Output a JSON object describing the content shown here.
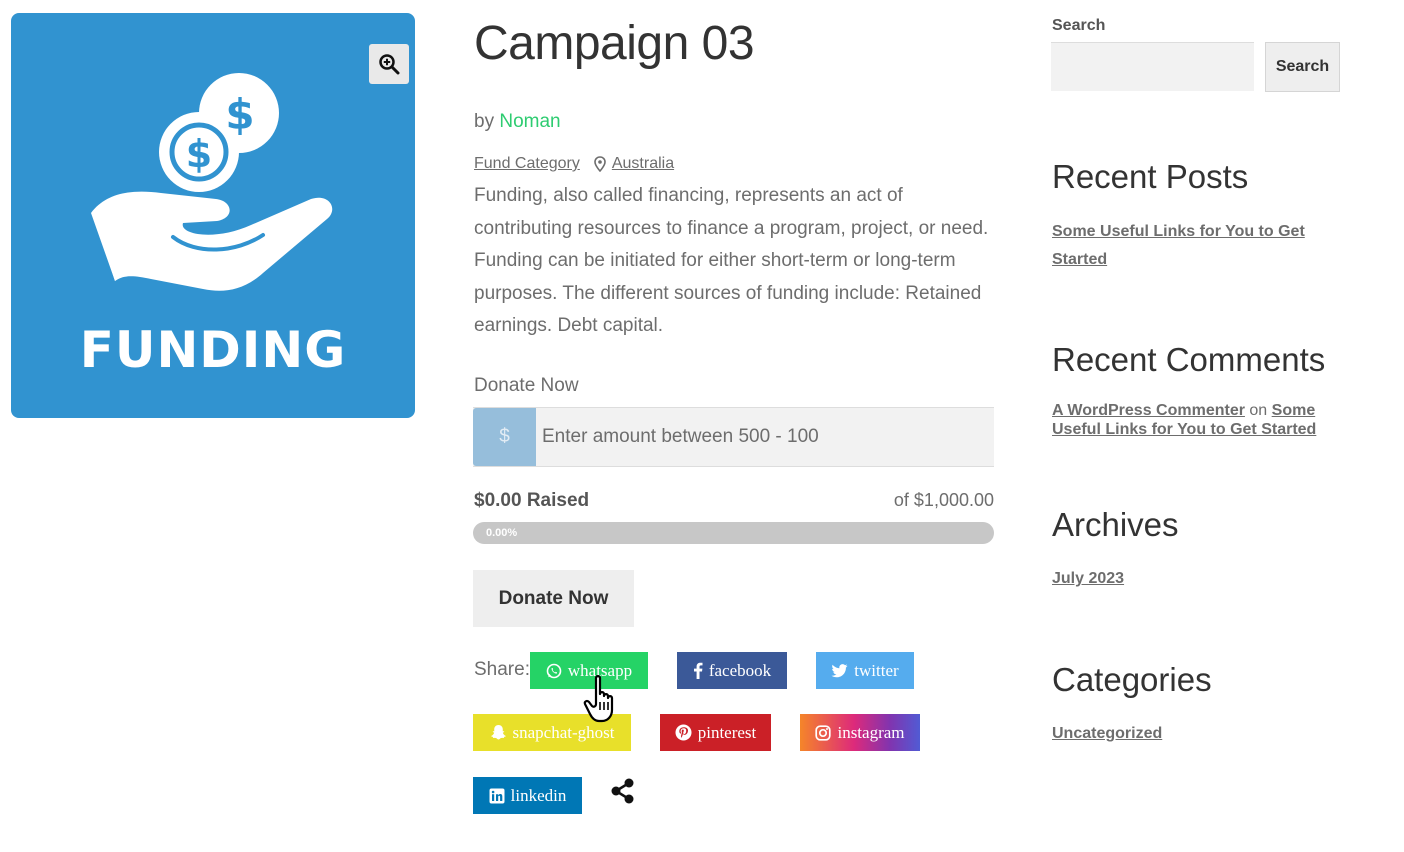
{
  "product": {
    "image_text": "FUNDING",
    "image_bg": "#3193d0",
    "zoom_icon": "magnifier-plus-icon"
  },
  "main": {
    "title": "Campaign 03",
    "by_label": "by",
    "author": "Noman",
    "category": "Fund Category",
    "location_icon": "map-pin-icon",
    "location": "Australia",
    "description": "Funding, also called financing, represents an act of contributing resources to finance a program, project, or need. Funding can be initiated for either short-term or long-term purposes. The different sources of funding include: Retained earnings. Debt capital.",
    "donate_label": "Donate Now",
    "currency_symbol": "$",
    "amount_placeholder": "Enter amount between 500 - 100",
    "raised": "$0.00 Raised",
    "goal": "of $1,000.00",
    "progress_text": "0.00%",
    "progress_fraction": 0,
    "donate_button": "Donate Now",
    "share_label": "Share:",
    "share_buttons": [
      {
        "label": "whatsapp",
        "icon": "whatsapp-icon",
        "color": "#25d366"
      },
      {
        "label": "facebook",
        "icon": "facebook-icon",
        "color": "#3b5998"
      },
      {
        "label": "twitter",
        "icon": "twitter-icon",
        "color": "#55acee"
      },
      {
        "label": "snapchat-ghost",
        "icon": "snapchat-icon",
        "color": "#e8e02a"
      },
      {
        "label": "pinterest",
        "icon": "pinterest-icon",
        "color": "#cb2027"
      },
      {
        "label": "instagram",
        "icon": "instagram-icon",
        "color": "#e4405f"
      },
      {
        "label": "linkedin",
        "icon": "linkedin-icon",
        "color": "#0077b5"
      }
    ],
    "share_more_icon": "share-icon"
  },
  "sidebar": {
    "search_label": "Search",
    "search_button": "Search",
    "recent_posts_title": "Recent Posts",
    "recent_posts": [
      "Some Useful Links for You to Get Started"
    ],
    "recent_comments_title": "Recent Comments",
    "comment_author": "A WordPress Commenter",
    "comment_on": "on",
    "comment_post": "Some Useful Links for You to Get Started",
    "archives_title": "Archives",
    "archives": [
      "July 2023"
    ],
    "categories_title": "Categories",
    "categories": [
      "Uncategorized"
    ]
  },
  "colors": {
    "accent_green": "#2ecc71",
    "text": "#6d6d6d",
    "heading": "#333333"
  }
}
